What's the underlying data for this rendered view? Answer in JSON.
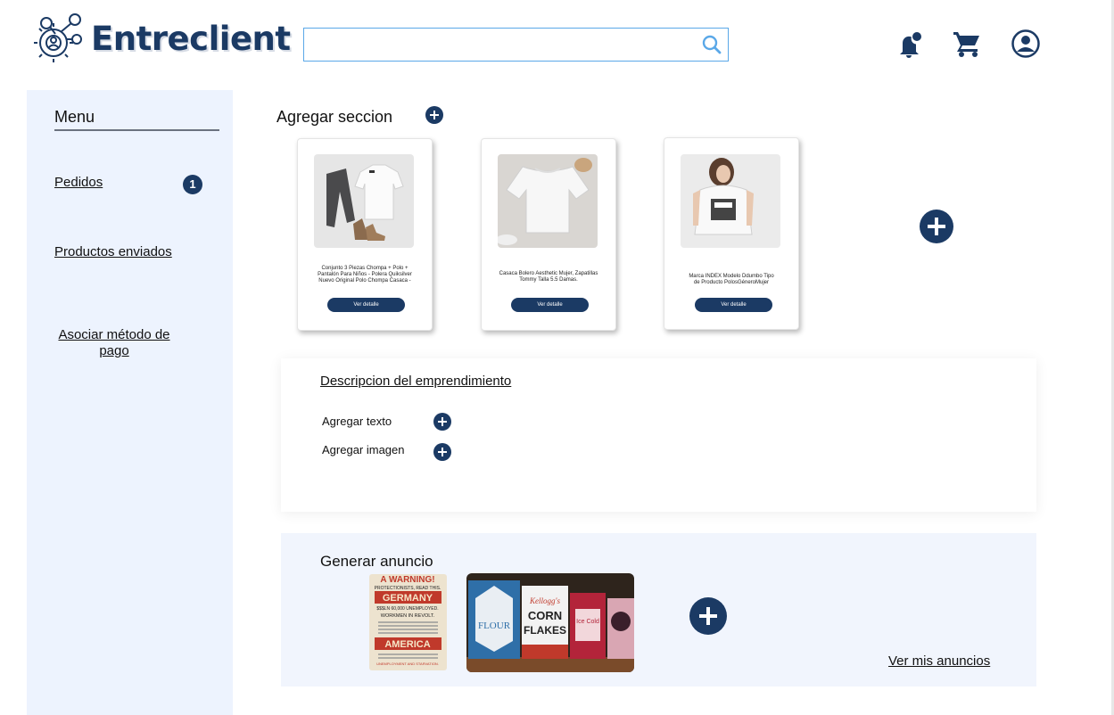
{
  "header": {
    "logo_text": "Entreclient",
    "search": {
      "value": "",
      "placeholder": ""
    },
    "icons": [
      "notification-bell-icon",
      "shopping-cart-icon",
      "user-account-icon"
    ]
  },
  "sidebar": {
    "title": "Menu",
    "items": [
      {
        "label": "Pedidos",
        "badge": "1"
      },
      {
        "label": "Productos enviados"
      },
      {
        "label": "Asociar método de pago"
      }
    ]
  },
  "section": {
    "title": "Agregar seccion",
    "products": [
      {
        "description": "Conjunto 3 Piezas Chompa + Polo + Pantalón Para Niños - Polera Quiksilver Nuevo Original Polo Chompa Casaca -",
        "button": "Ver detalle"
      },
      {
        "description": "Casaca Bolero Aesthetic Mujer, Zapatillas Tommy Talla 5.5 Damas.",
        "button": "Ver detalle"
      },
      {
        "description": "Marca INDEX Modelo Ddumbo Tipo de Producto PolosGéneroMujer",
        "button": "Ver detalle"
      }
    ]
  },
  "description": {
    "title": "Descripcion del emprendimiento",
    "add_text": "Agregar texto",
    "add_image": "Agregar imagen"
  },
  "ads": {
    "title": "Generar anuncio",
    "poster": {
      "lines": [
        "A WARNING!",
        "PROTECTIONISTS, READ THIS.",
        "GERMANY",
        "$$$LN 60,000 UNEMPLOYED.",
        "WORKMEN IN REVOLT.",
        "AMERICA",
        "UNEMPLOYMENT AND STARVATION."
      ]
    },
    "tins": {
      "flour": "FLOUR",
      "kelloggs": "Kellogg's",
      "corn": "CORN",
      "flakes": "FLAKES",
      "ice_cold": "Ice Cold"
    },
    "view_link": "Ver mis anuncios"
  },
  "colors": {
    "navy": "#1b3a64",
    "sidebar_bg": "#edf3fe",
    "ad_bg": "#f1f5fd",
    "search_border": "#5aa8e8"
  }
}
